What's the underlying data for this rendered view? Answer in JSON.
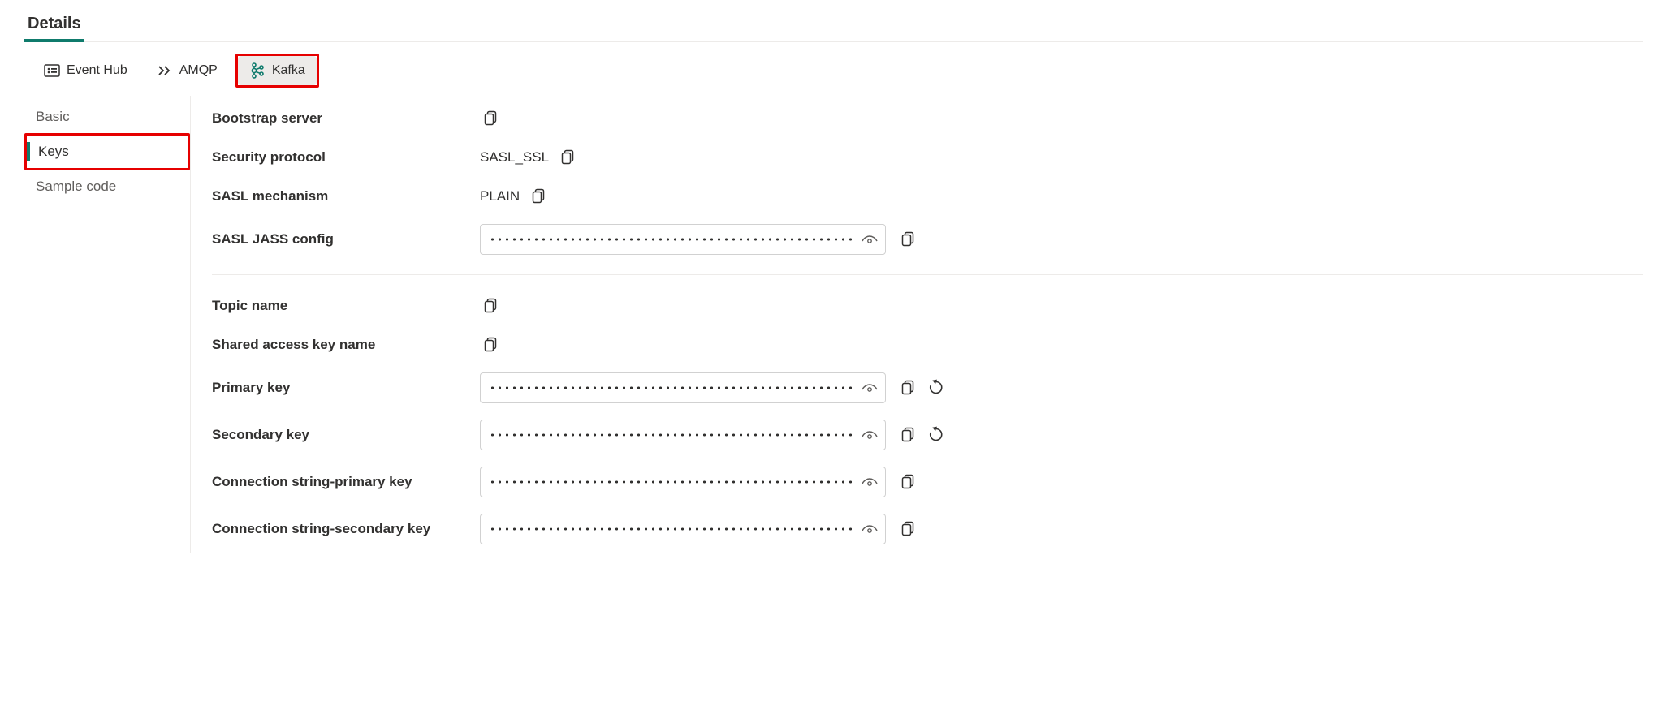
{
  "topTab": {
    "details": "Details"
  },
  "protoTabs": {
    "eventhub": "Event Hub",
    "amqp": "AMQP",
    "kafka": "Kafka"
  },
  "sideNav": {
    "basic": "Basic",
    "keys": "Keys",
    "sample": "Sample code"
  },
  "labels": {
    "bootstrap": "Bootstrap server",
    "securityProtocol": "Security protocol",
    "saslMechanism": "SASL mechanism",
    "saslJass": "SASL JASS config",
    "topicName": "Topic name",
    "sharedAccessKeyName": "Shared access key name",
    "primaryKey": "Primary key",
    "secondaryKey": "Secondary key",
    "connPrimary": "Connection string-primary key",
    "connSecondary": "Connection string-secondary key"
  },
  "values": {
    "securityProtocol": "SASL_SSL",
    "saslMechanism": "PLAIN"
  }
}
